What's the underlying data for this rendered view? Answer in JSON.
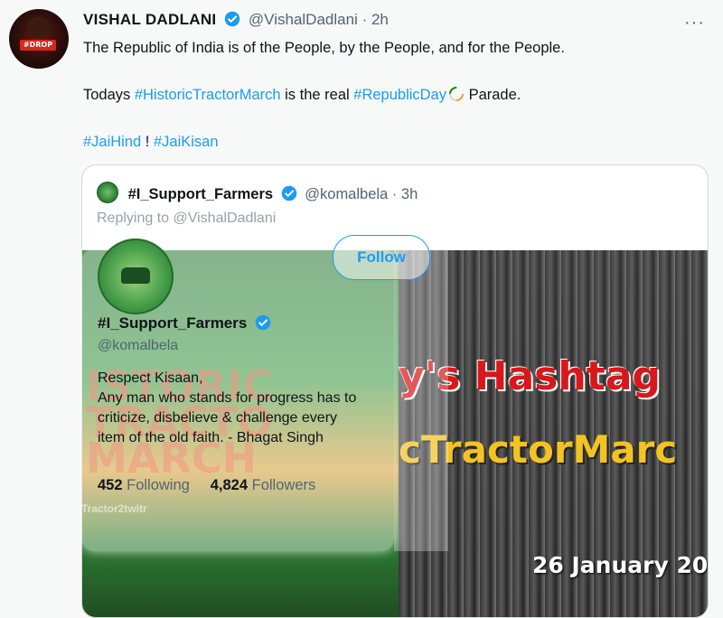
{
  "tweet": {
    "author_name": "VISHAL DADLANI",
    "handle": "@VishalDadlani",
    "separator": "·",
    "time": "2h",
    "avatar_badge": "#DROP",
    "more_icon": "more-horizontal-icon",
    "line1": "The Republic of India is of the People, by the People, and for the People.",
    "line2_prefix": "Todays ",
    "line2_tag1": "#HistoricTractorMarch",
    "line2_middle": " is the real ",
    "line2_tag2": "#RepublicDay",
    "line2_suffix": " Parade.",
    "line3_tag1": "#JaiHind",
    "line3_sep": " ! ",
    "line3_tag2": "#JaiKisan"
  },
  "quote": {
    "name": "#I_Support_Farmers",
    "handle": "@komalbela",
    "separator": "·",
    "time": "3h",
    "reply": "Replying to @VishalDadlani",
    "image_left_text": "ISTORIC\nTRACTO\nMARCH",
    "image_title1": "y's Hashtag",
    "image_title2": "cTractorMarc",
    "image_date": "26 January 20"
  },
  "hover_card": {
    "follow_label": "Follow",
    "name": "#I_Support_Farmers",
    "handle": "@komalbela",
    "bio_line1": "Respect Kisaan,",
    "bio_line2": "Any man who stands for progress has to",
    "bio_line3": "criticize, disbelieve & challenge every",
    "bio_line4": "item of the old faith. - Bhagat Singh",
    "following_count": "452",
    "following_label": "Following",
    "followers_count": "4,824",
    "followers_label": "Followers",
    "footer_text": "Tractor2twitr"
  },
  "colors": {
    "link": "#1d9bf0",
    "muted": "#536471",
    "verified": "#1d9bf0"
  }
}
